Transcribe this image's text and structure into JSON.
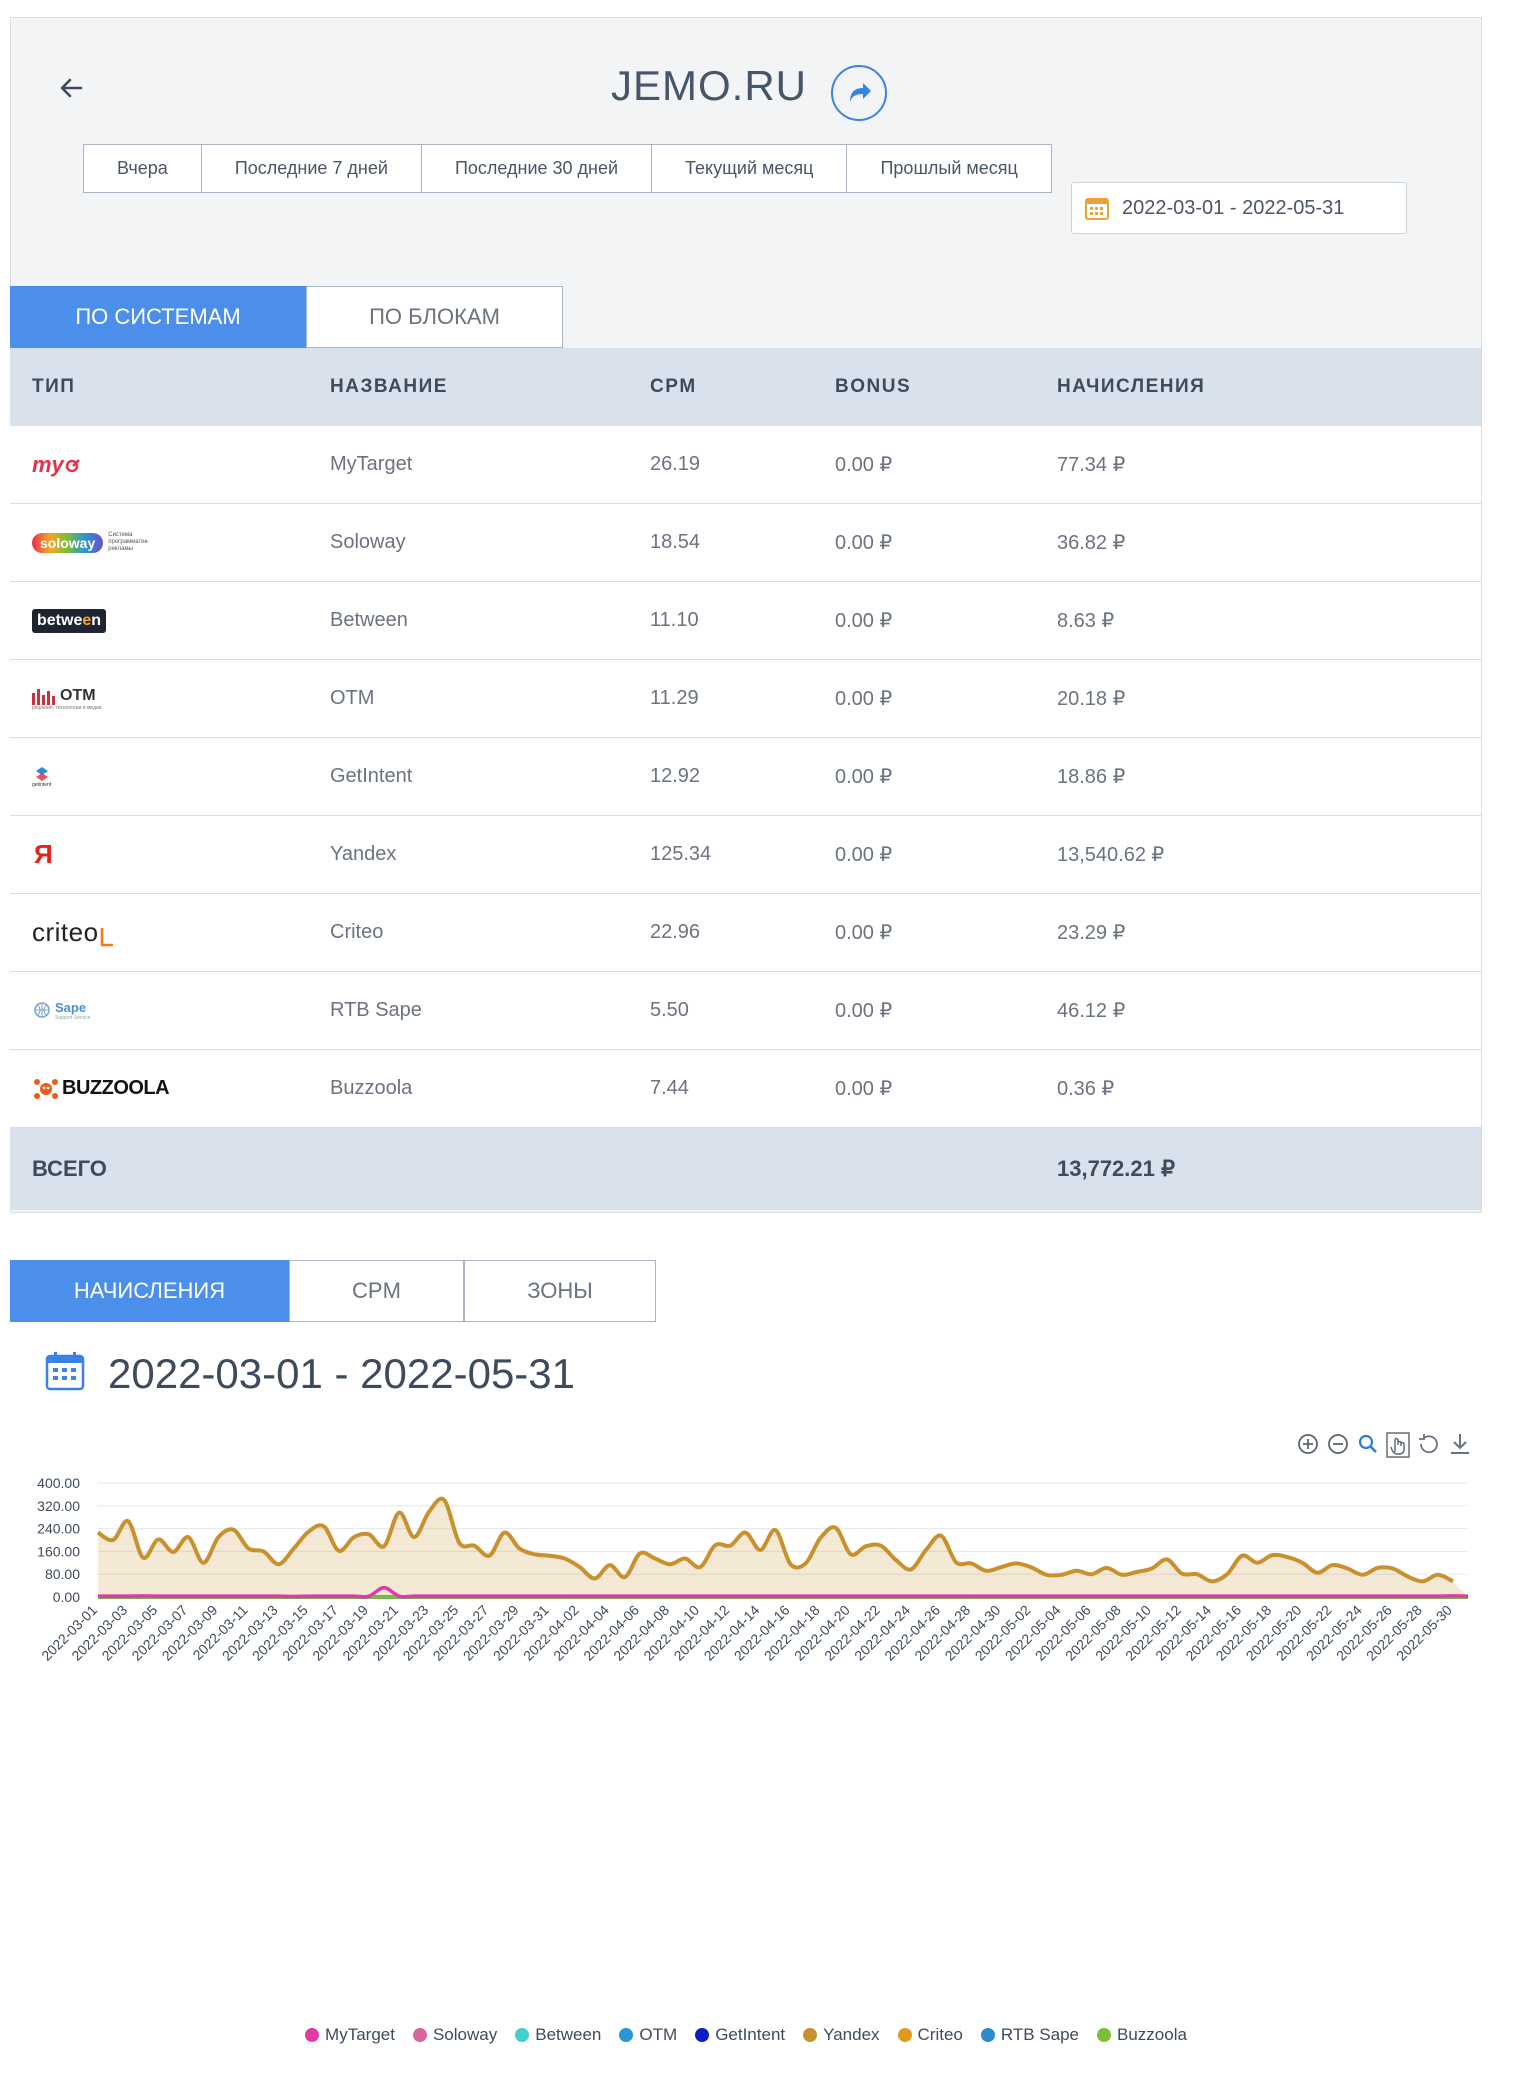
{
  "header": {
    "title": "JEMO.RU"
  },
  "periods": [
    "Вчера",
    "Последние 7 дней",
    "Последние 30 дней",
    "Текущий месяц",
    "Прошлый месяц"
  ],
  "date_range": "2022-03-01 - 2022-05-31",
  "view_tabs": [
    "ПО СИСТЕМАМ",
    "ПО БЛОКАМ"
  ],
  "table": {
    "headers": [
      "ТИП",
      "НАЗВАНИЕ",
      "CPM",
      "BONUS",
      "НАЧИСЛЕНИЯ"
    ],
    "rows": [
      {
        "logo": "mytarget",
        "logo_text": "my",
        "name": "MyTarget",
        "cpm": "26.19",
        "bonus": "0.00 ₽",
        "revenue": "77.34 ₽"
      },
      {
        "logo": "soloway",
        "logo_text": "soloway",
        "logo_caption": "Система программатик-рекламы",
        "name": "Soloway",
        "cpm": "18.54",
        "bonus": "0.00 ₽",
        "revenue": "36.82 ₽"
      },
      {
        "logo": "between",
        "logo_text": "betwe",
        "logo_text2": "e",
        "logo_text3": "n",
        "name": "Between",
        "cpm": "11.10",
        "bonus": "0.00 ₽",
        "revenue": "8.63 ₽"
      },
      {
        "logo": "otm",
        "logo_text": "OTM",
        "logo_caption": "решения, технологии и медиа",
        "name": "OTM",
        "cpm": "11.29",
        "bonus": "0.00 ₽",
        "revenue": "20.18 ₽"
      },
      {
        "logo": "getintent",
        "logo_text": "getintent",
        "name": "GetIntent",
        "cpm": "12.92",
        "bonus": "0.00 ₽",
        "revenue": "18.86 ₽"
      },
      {
        "logo": "yandex",
        "logo_text": "Я",
        "name": "Yandex",
        "cpm": "125.34",
        "bonus": "0.00 ₽",
        "revenue": "13,540.62 ₽"
      },
      {
        "logo": "criteo",
        "logo_text": "criteo",
        "name": "Criteo",
        "cpm": "22.96",
        "bonus": "0.00 ₽",
        "revenue": "23.29 ₽"
      },
      {
        "logo": "sape",
        "logo_text": "Sape",
        "logo_caption": "Support Service",
        "name": "RTB Sape",
        "cpm": "5.50",
        "bonus": "0.00 ₽",
        "revenue": "46.12 ₽"
      },
      {
        "logo": "buzzoola",
        "logo_text": "BUZZOOLA",
        "name": "Buzzoola",
        "cpm": "7.44",
        "bonus": "0.00 ₽",
        "revenue": "0.36 ₽"
      }
    ],
    "total_label": "ВСЕГО",
    "total_value": "13,772.21 ₽"
  },
  "chart_tabs": [
    "НАЧИСЛЕНИЯ",
    "CPM",
    "ЗОНЫ"
  ],
  "chart_data": {
    "type": "area",
    "title": "2022-03-01 - 2022-05-31",
    "ylim": [
      0,
      400
    ],
    "yticks": [
      "400.00",
      "320.00",
      "240.00",
      "160.00",
      "80.00",
      "0.00"
    ],
    "xtick_labels": [
      "2022-03-01",
      "2022-03-03",
      "2022-03-05",
      "2022-03-07",
      "2022-03-09",
      "2022-03-11",
      "2022-03-13",
      "2022-03-15",
      "2022-03-17",
      "2022-03-19",
      "2022-03-21",
      "2022-03-23",
      "2022-03-25",
      "2022-03-27",
      "2022-03-29",
      "2022-03-31",
      "2022-04-02",
      "2022-04-04",
      "2022-04-06",
      "2022-04-08",
      "2022-04-10",
      "2022-04-12",
      "2022-04-14",
      "2022-04-16",
      "2022-04-18",
      "2022-04-20",
      "2022-04-22",
      "2022-04-24",
      "2022-04-26",
      "2022-04-28",
      "2022-04-30",
      "2022-05-02",
      "2022-05-04",
      "2022-05-06",
      "2022-05-08",
      "2022-05-10",
      "2022-05-12",
      "2022-05-14",
      "2022-05-16",
      "2022-05-18",
      "2022-05-20",
      "2022-05-22",
      "2022-05-24",
      "2022-05-26",
      "2022-05-28",
      "2022-05-30"
    ],
    "series": [
      {
        "name": "MyTarget",
        "color": "#e03aa6",
        "values": [
          3,
          3,
          3,
          4,
          3,
          3,
          3,
          3,
          3,
          3,
          3,
          3,
          3,
          2,
          3,
          3,
          3,
          3,
          3,
          33,
          3,
          3,
          3,
          3,
          3,
          3,
          3,
          3,
          3,
          3,
          3,
          3,
          3,
          3,
          3,
          3,
          3,
          3,
          3,
          3,
          3,
          3,
          3,
          3,
          3,
          3,
          3,
          3,
          3,
          3,
          3,
          3,
          3,
          3,
          3,
          3,
          3,
          3,
          3,
          3,
          3,
          3,
          3,
          3,
          3,
          3,
          3,
          3,
          3,
          3,
          3,
          3,
          3,
          3,
          3,
          3,
          3,
          3,
          3,
          3,
          3,
          3,
          3,
          3,
          3,
          3,
          3,
          3,
          3,
          3,
          4,
          3
        ]
      },
      {
        "name": "Soloway",
        "color": "#d9659e",
        "values": [
          1,
          1,
          1,
          1,
          1,
          1,
          1,
          1,
          1,
          1,
          1,
          1,
          1,
          1,
          1,
          1,
          1,
          1,
          1,
          1,
          1,
          1,
          1,
          1,
          1,
          1,
          1,
          1,
          1,
          1,
          1,
          1,
          1,
          1,
          1,
          1,
          1,
          1,
          1,
          1,
          1,
          1,
          1,
          1,
          1,
          1,
          1,
          1,
          1,
          1,
          1,
          1,
          1,
          1,
          1,
          1,
          1,
          1,
          1,
          1,
          1,
          1,
          1,
          1,
          1,
          1,
          1,
          1,
          1,
          1,
          1,
          1,
          1,
          1,
          1,
          1,
          1,
          1,
          1,
          1,
          1,
          1,
          1,
          1,
          1,
          1,
          1,
          1,
          1,
          1,
          1,
          1
        ]
      },
      {
        "name": "Between",
        "color": "#3fd0d0",
        "values": [
          0,
          0,
          0,
          0,
          0,
          0,
          0,
          0,
          0,
          0,
          0,
          0,
          0,
          0,
          0,
          0,
          0,
          0,
          0,
          0,
          0,
          0,
          0,
          0,
          0,
          0,
          0,
          0,
          0,
          0,
          0,
          0,
          0,
          0,
          0,
          0,
          0,
          0,
          0,
          0,
          0,
          0,
          0,
          0,
          0,
          0,
          0,
          0,
          0,
          0,
          0,
          0,
          0,
          0,
          0,
          0,
          0,
          0,
          0,
          0,
          0,
          0,
          0,
          0,
          0,
          0,
          0,
          0,
          0,
          0,
          0,
          0,
          0,
          0,
          0,
          0,
          0,
          0,
          0,
          0,
          0,
          0,
          0,
          0,
          0,
          0,
          0,
          0,
          0,
          0,
          0,
          0
        ]
      },
      {
        "name": "OTM",
        "color": "#2b94d6",
        "values": [
          0,
          0,
          0,
          0,
          0,
          0,
          0,
          0,
          0,
          0,
          0,
          0,
          0,
          0,
          0,
          0,
          0,
          0,
          0,
          0,
          0,
          0,
          0,
          0,
          0,
          0,
          0,
          0,
          0,
          0,
          0,
          0,
          0,
          0,
          0,
          0,
          0,
          0,
          0,
          0,
          0,
          0,
          0,
          0,
          0,
          0,
          0,
          0,
          0,
          0,
          0,
          0,
          0,
          0,
          0,
          0,
          0,
          0,
          0,
          0,
          0,
          0,
          0,
          0,
          0,
          0,
          0,
          0,
          0,
          0,
          0,
          0,
          0,
          0,
          0,
          0,
          0,
          0,
          0,
          0,
          0,
          0,
          0,
          0,
          0,
          0,
          0,
          0,
          0,
          0,
          0,
          0
        ]
      },
      {
        "name": "GetIntent",
        "color": "#0a1fc4",
        "values": [
          0,
          0,
          0,
          0,
          0,
          0,
          0,
          0,
          0,
          0,
          0,
          0,
          0,
          0,
          0,
          0,
          0,
          0,
          0,
          0,
          0,
          0,
          0,
          0,
          0,
          0,
          0,
          0,
          0,
          0,
          0,
          0,
          0,
          0,
          0,
          0,
          0,
          0,
          0,
          0,
          0,
          0,
          0,
          0,
          0,
          0,
          0,
          0,
          0,
          0,
          0,
          0,
          0,
          0,
          0,
          0,
          0,
          0,
          0,
          0,
          0,
          0,
          0,
          0,
          0,
          0,
          0,
          0,
          0,
          0,
          0,
          0,
          0,
          0,
          0,
          0,
          0,
          0,
          0,
          0,
          0,
          0,
          0,
          0,
          0,
          0,
          0,
          0,
          0,
          0,
          0,
          0
        ]
      },
      {
        "name": "Yandex",
        "color": "#c9902e",
        "values": [
          226,
          200,
          266,
          138,
          202,
          158,
          210,
          120,
          210,
          236,
          170,
          160,
          115,
          170,
          230,
          248,
          162,
          210,
          220,
          178,
          296,
          210,
          300,
          340,
          190,
          180,
          145,
          226,
          170,
          150,
          145,
          135,
          105,
          65,
          112,
          70,
          153,
          135,
          115,
          135,
          105,
          182,
          180,
          226,
          165,
          235,
          115,
          118,
          208,
          243,
          150,
          178,
          180,
          130,
          97,
          165,
          215,
          122,
          118,
          92,
          105,
          118,
          104,
          78,
          78,
          92,
          80,
          102,
          78,
          88,
          100,
          132,
          82,
          80,
          55,
          80,
          145,
          120,
          147,
          140,
          120,
          85,
          112,
          100,
          78,
          102,
          100,
          72,
          55,
          78,
          55
        ]
      },
      {
        "name": "Criteo",
        "color": "#e09b1f",
        "values": [
          0,
          0,
          0,
          0,
          0,
          0,
          0,
          0,
          0,
          0,
          0,
          0,
          0,
          0,
          0,
          0,
          0,
          0,
          0,
          0,
          0,
          0,
          0,
          0,
          0,
          0,
          0,
          0,
          0,
          0,
          0,
          0,
          0,
          0,
          0,
          0,
          0,
          0,
          0,
          0,
          0,
          0,
          0,
          0,
          0,
          0,
          0,
          0,
          0,
          0,
          0,
          0,
          0,
          0,
          0,
          0,
          0,
          0,
          0,
          0,
          0,
          0,
          0,
          0,
          0,
          0,
          0,
          0,
          0,
          0,
          0,
          0,
          0,
          0,
          0,
          0,
          0,
          0,
          0,
          0,
          0,
          0,
          0,
          0,
          0,
          0,
          0,
          0,
          0,
          0,
          0,
          0
        ]
      },
      {
        "name": "RTB Sape",
        "color": "#2b8ad0",
        "values": [
          0,
          0,
          0,
          0,
          0,
          0,
          0,
          0,
          0,
          0,
          0,
          0,
          0,
          0,
          0,
          0,
          0,
          0,
          0,
          0,
          0,
          0,
          0,
          0,
          0,
          0,
          0,
          0,
          0,
          0,
          0,
          0,
          0,
          0,
          0,
          0,
          0,
          0,
          0,
          0,
          0,
          0,
          0,
          0,
          0,
          0,
          0,
          0,
          0,
          0,
          0,
          0,
          0,
          0,
          0,
          0,
          0,
          0,
          0,
          0,
          0,
          0,
          0,
          0,
          0,
          0,
          0,
          0,
          0,
          0,
          0,
          0,
          0,
          0,
          0,
          0,
          0,
          0,
          0,
          0,
          0,
          0,
          0,
          0,
          0,
          0,
          0,
          0,
          0,
          0,
          0,
          0
        ]
      },
      {
        "name": "Buzzoola",
        "color": "#7cbd3a",
        "values": [
          0,
          0,
          0,
          0,
          0,
          0,
          0,
          0,
          0,
          0,
          0,
          0,
          0,
          0,
          0,
          0,
          0,
          0,
          0,
          0,
          0,
          0,
          0,
          0,
          0,
          0,
          0,
          0,
          0,
          0,
          0,
          0,
          0,
          0,
          0,
          0,
          0,
          0,
          0,
          0,
          0,
          0,
          0,
          0,
          0,
          0,
          0,
          0,
          0,
          0,
          0,
          0,
          0,
          0,
          0,
          0,
          0,
          0,
          0,
          0,
          0,
          0,
          0,
          0,
          0,
          0,
          0,
          0,
          0,
          0,
          0,
          0,
          0,
          0,
          0,
          0,
          0,
          0,
          0,
          0,
          0,
          0,
          0,
          0,
          0,
          0,
          0,
          0,
          0,
          0,
          0,
          0
        ]
      }
    ],
    "legend_position": "bottom",
    "grid": true
  },
  "icons": {
    "back": "arrow-left-icon",
    "share": "share-icon",
    "calendar": "calendar-icon",
    "toolbar": [
      "zoom-in-icon",
      "zoom-out-icon",
      "zoom-select-icon",
      "pan-hand-icon",
      "reset-icon",
      "download-icon"
    ]
  }
}
